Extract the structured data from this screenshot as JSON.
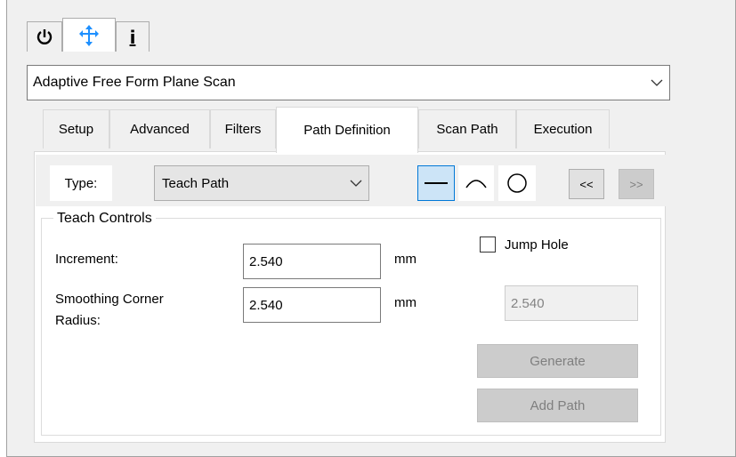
{
  "top_tabs": [
    {
      "icon": "power-icon"
    },
    {
      "icon": "move-axes-icon"
    },
    {
      "icon": "info-icon",
      "label": "i"
    }
  ],
  "scan_type": {
    "selected": "Adaptive Free Form Plane Scan"
  },
  "tabs": [
    {
      "label": "Setup"
    },
    {
      "label": "Advanced"
    },
    {
      "label": "Filters"
    },
    {
      "label": "Path Definition",
      "active": true
    },
    {
      "label": "Scan Path"
    },
    {
      "label": "Execution"
    }
  ],
  "path_type": {
    "label": "Type:",
    "selected": "Teach Path"
  },
  "shape_buttons": [
    "line-icon",
    "arc-icon",
    "circle-icon"
  ],
  "nav": {
    "prev_label": "<<",
    "next_label": ">>"
  },
  "teach_controls": {
    "title": "Teach Controls",
    "increment_label": "Increment:",
    "increment_value": "2.540",
    "increment_unit": "mm",
    "smoothing_label_1": "Smoothing Corner",
    "smoothing_label_2": "Radius:",
    "smoothing_value": "2.540",
    "smoothing_unit": "mm",
    "jump_hole_label": "Jump Hole",
    "jump_hole_checked": false,
    "jump_hole_value": "2.540",
    "generate_label": "Generate",
    "add_path_label": "Add Path"
  },
  "colors": {
    "accent": "#0078d7",
    "selected_bg": "#cce4f7"
  }
}
